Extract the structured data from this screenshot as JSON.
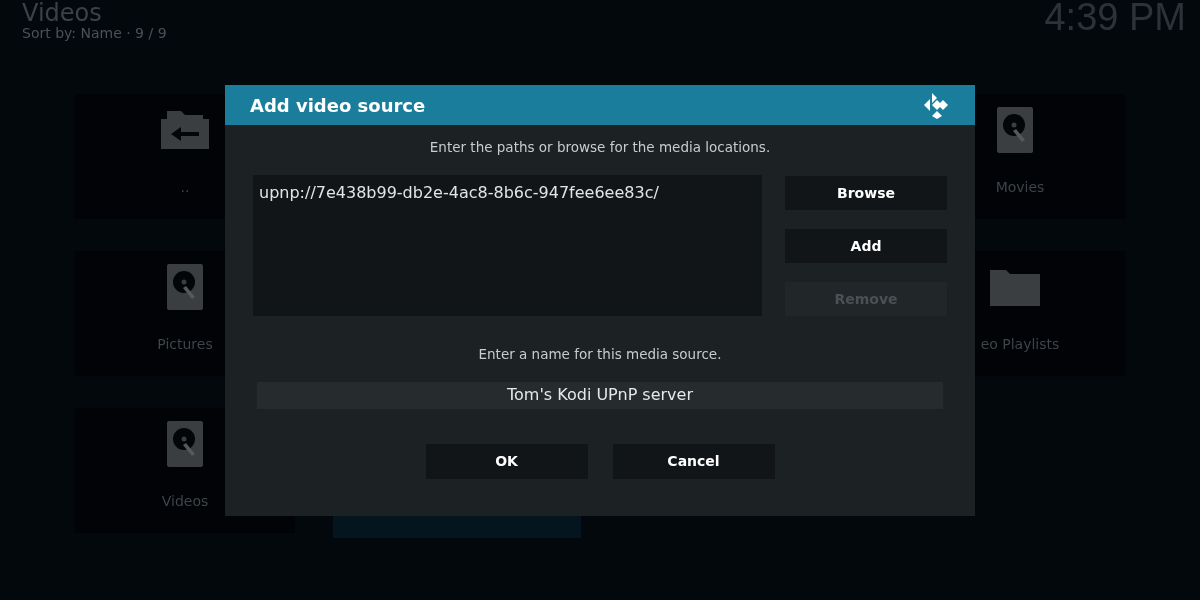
{
  "header": {
    "title": "Videos",
    "subtitle": "Sort by: Name · 9 / 9",
    "clock": "4:39 PM"
  },
  "left_tiles": [
    {
      "label": "..",
      "kind": "back"
    },
    {
      "label": "Pictures",
      "kind": "drive"
    },
    {
      "label": "Videos",
      "kind": "drive"
    }
  ],
  "right_tiles": [
    {
      "label": "Movies",
      "kind": "drive"
    },
    {
      "label": "eo Playlists",
      "kind": "folder"
    }
  ],
  "dialog": {
    "title": "Add video source",
    "paths_prompt": "Enter the paths or browse for the media locations.",
    "paths": [
      "upnp://7e438b99-db2e-4ac8-8b6c-947fee6ee83c/"
    ],
    "side_buttons": [
      {
        "label": "Browse",
        "disabled": false
      },
      {
        "label": "Add",
        "disabled": false
      },
      {
        "label": "Remove",
        "disabled": true
      }
    ],
    "name_prompt": "Enter a name for this media source.",
    "name_value": "Tom's Kodi UPnP server",
    "buttons": [
      {
        "label": "OK"
      },
      {
        "label": "Cancel"
      }
    ]
  }
}
